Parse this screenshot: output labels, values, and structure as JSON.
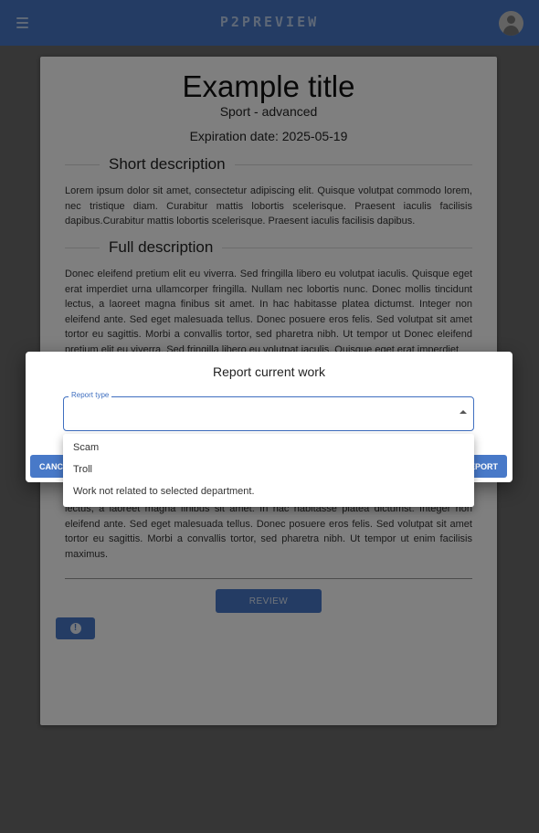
{
  "appbar": {
    "brand": "P2PREVIEW",
    "menu_icon": "hamburger-menu-icon",
    "avatar_icon": "account-avatar-icon",
    "color": "#2f63b8"
  },
  "work": {
    "title": "Example title",
    "category": "Sport - advanced",
    "expiration": "Expiration date: 2025-05-19",
    "short_heading": "Short description",
    "short_text": "Lorem ipsum dolor sit amet, consectetur adipiscing elit. Quisque volutpat commodo lorem, nec tristique diam. Curabitur mattis lobortis scelerisque. Praesent iaculis facilisis dapibus.Curabitur mattis lobortis scelerisque. Praesent iaculis facilisis dapibus.",
    "full_heading": "Full description",
    "full_text_top": "Donec eleifend pretium elit eu viverra. Sed fringilla libero eu volutpat iaculis. Quisque eget erat imperdiet urna ullamcorper fringilla. Nullam nec lobortis nunc. Donec mollis tincidunt lectus, a laoreet magna finibus sit amet. In hac habitasse platea dictumst. Integer non eleifend ante. Sed eget malesuada tellus. Donec posuere eros felis. Sed volutpat sit amet tortor eu sagittis. Morbi a convallis tortor, sed pharetra nibh. Ut tempor ut Donec eleifend pretium elit eu viverra. Sed fringilla libero eu volutpat iaculis. Quisque eget erat imperdiet",
    "full_text_bottom": "lectus, a laoreet magna finibus sit amet. In hac habitasse platea dictumst. Integer non eleifend ante. Sed eget malesuada tellus. Donec posuere eros felis. Sed volutpat sit amet tortor eu sagittis. Morbi a convallis tortor, sed pharetra nibh. Ut tempor ut enim facilisis maximus.",
    "review_label": "REVIEW",
    "report_icon": "alert-circle-icon"
  },
  "dialog": {
    "title": "Report current work",
    "field_label": "Report type",
    "field_value": "",
    "cancel_label": "CANCEL",
    "report_label": "REPORT",
    "options": [
      "Scam",
      "Troll",
      "Work not related to selected department."
    ]
  }
}
